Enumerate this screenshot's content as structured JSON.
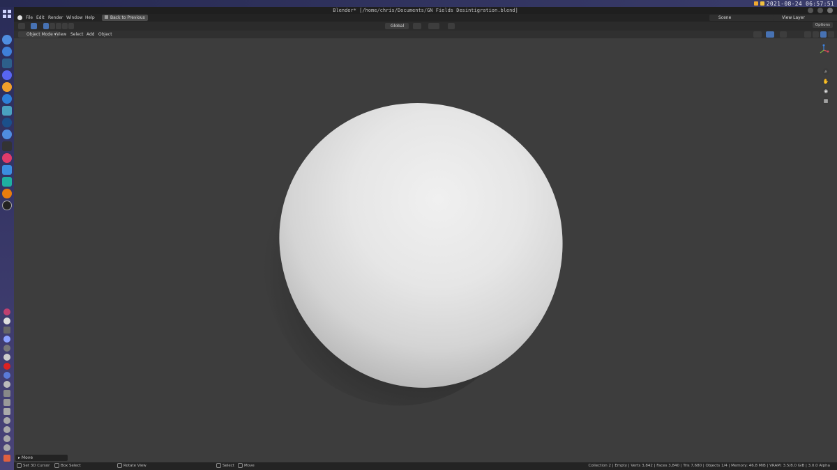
{
  "os": {
    "clock": "2021-08-24 06:57:51"
  },
  "window": {
    "title": "Blender* [/home/chris/Documents/GN Fields Desintigration.blend]"
  },
  "menu": {
    "items": [
      "File",
      "Edit",
      "Render",
      "Window",
      "Help"
    ],
    "back_button": "Back to Previous",
    "scene": "Scene",
    "view_layer": "View Layer"
  },
  "toolbar": {
    "transform_orientation": "Global",
    "options_label": "Options"
  },
  "viewport_header": {
    "mode": "Object Mode",
    "menus": [
      "View",
      "Select",
      "Add",
      "Object"
    ]
  },
  "operator_panel": {
    "label": "Move"
  },
  "statusbar": {
    "set_cursor": "Set 3D Cursor",
    "box_select": "Box Select",
    "rotate_view": "Rotate View",
    "select": "Select",
    "move": "Move",
    "stats": "Collection 2 | Empty | Verts 3,842 | Faces 3,840 | Tris 7,680 | Objects 1/4 | Memory: 46.8 MiB | VRAM: 3.5/8.0 GiB | 3.0.0 Alpha"
  }
}
